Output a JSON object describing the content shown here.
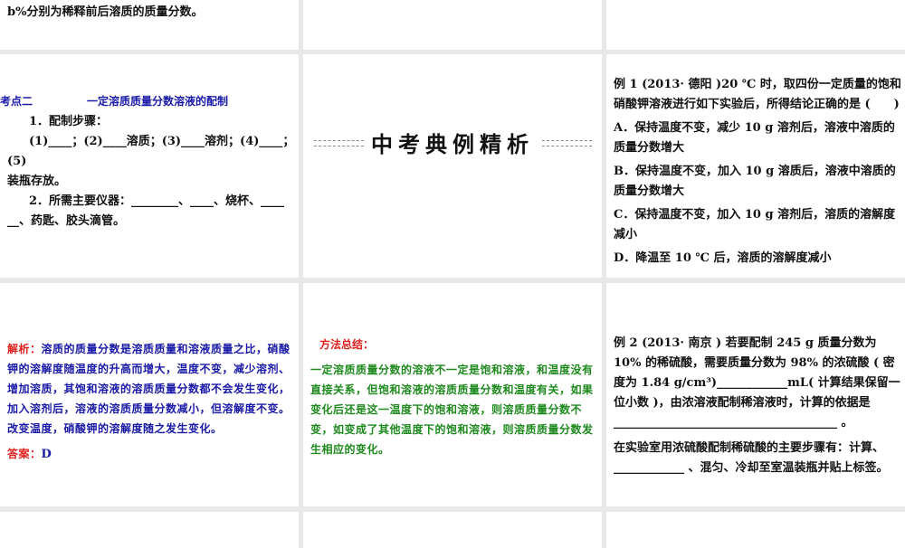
{
  "slides": [
    {
      "text": "b%分别为稀释前后溶质的质量分数。"
    },
    {
      "title": "考点二",
      "subtitle": "一定溶质质量分数溶液的配制",
      "lines": [
        "1．配制步骤：",
        "(1)____；(2)____溶质；(3)____溶剂；(4)____；(5)",
        "装瓶存放。",
        "2．所需主要仪器：________、____、烧杯、____",
        "__、药匙、胶头滴管。"
      ]
    },
    {
      "heading": "中考典例精析"
    },
    {
      "question": "例 1 (2013· 德阳 )20 ℃ 时，取四份一定质量的饱和硝酸钾溶液进行如下实验后，所得结论正确的是 (　　)",
      "options": [
        "A．保持温度不变，减少 10 g 溶剂后，溶液中溶质的质量分数增大",
        "B．保持温度不变，加入 10 g 溶质后，溶液中溶质的质量分数增大",
        "C．保持温度不变，加入 10 g 溶剂后，溶质的溶解度减小",
        "D．降温至 10 ℃ 后，溶质的溶解度减小"
      ]
    },
    {
      "analysis_label": "解析：",
      "analysis": "溶质的质量分数是溶质质量和溶液质量之比，硝酸钾的溶解度随温度的升高而增大，温度不变，减少溶剂、增加溶质，其饱和溶液的溶质质量分数都不会发生变化，加入溶剂后，溶液的溶质质量分数减小，但溶解度不变。改变温度，硝酸钾的溶解度随之发生变化。",
      "answer_label": "答案：",
      "answer": "D"
    },
    {
      "title": "方法总结：",
      "body": "一定溶质质量分数的溶液不一定是饱和溶液，和温度没有直接关系，但饱和溶液的溶质质量分数和温度有关，如果变化后还是这一温度下的饱和溶液，则溶质质量分数不变，如变成了其他温度下的饱和溶液，则溶质质量分数发生相应的变化。"
    },
    {
      "question": "例 2 (2013· 南京 ) 若要配制 245 g 质量分数为 10% 的稀硫酸，需要质量分数为 98% 的浓硫酸 ( 密度为 1.84 g/cm³)____________mL( 计算结果保留一位小数 )，由浓溶液配制稀溶液时，计算的依据是",
      "blank_line": "______________________________________ 。",
      "steps": "在实验室用浓硫酸配制稀硫酸的主要步骤有：计算、 ____________ 、混匀、冷却至室温装瓶并贴上标签。"
    }
  ]
}
